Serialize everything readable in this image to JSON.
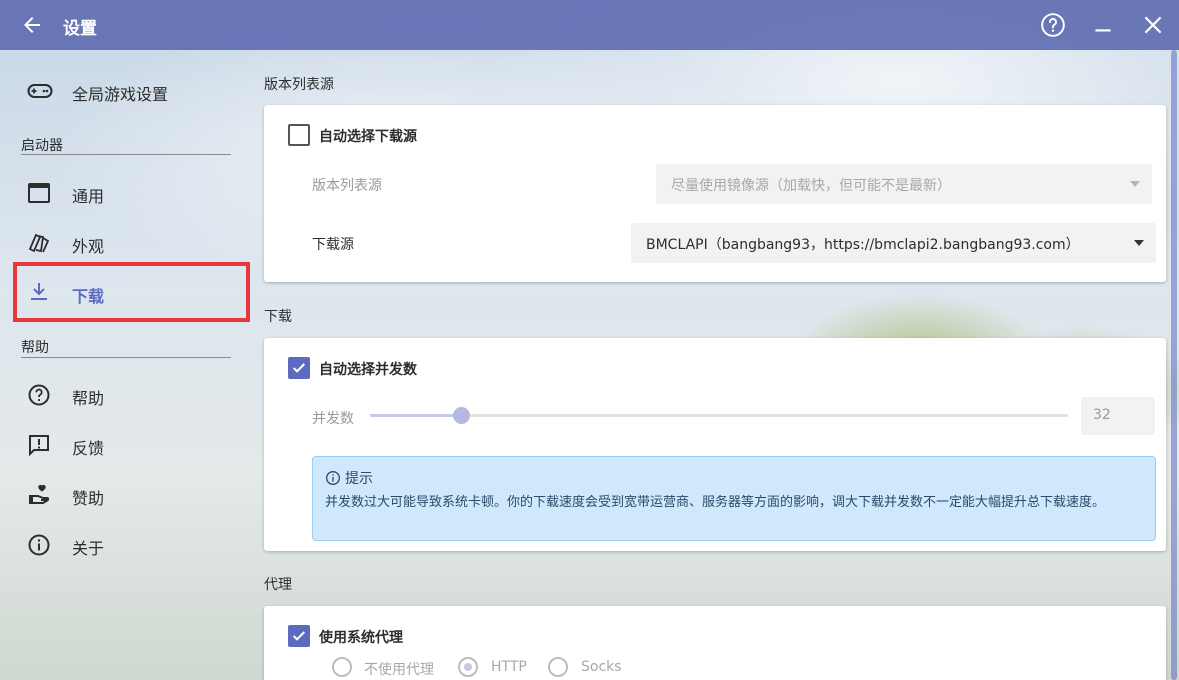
{
  "window": {
    "title": "设置",
    "accent_color": "#5c6bc0",
    "titlebar_color": "#606eb2"
  },
  "titlebar_icons": {
    "back": "arrow-left-icon",
    "help": "help-circle-icon",
    "minimize": "minimize-icon",
    "close": "close-icon"
  },
  "sidebar": {
    "top_item": {
      "label": "全局游戏设置",
      "icon": "gamepad-icon"
    },
    "launcher_section": "启动器",
    "launcher_items": [
      {
        "label": "通用",
        "icon": "window-icon"
      },
      {
        "label": "外观",
        "icon": "cards-icon"
      },
      {
        "label": "下载",
        "icon": "download-icon",
        "active": true
      }
    ],
    "help_section": "帮助",
    "help_items": [
      {
        "label": "帮助",
        "icon": "help-circle-icon"
      },
      {
        "label": "反馈",
        "icon": "feedback-icon"
      },
      {
        "label": "赞助",
        "icon": "donate-icon"
      },
      {
        "label": "关于",
        "icon": "info-icon"
      }
    ]
  },
  "version_source": {
    "group_title": "版本列表源",
    "auto_checkbox_label": "自动选择下载源",
    "auto_checked": false,
    "list_source_label": "版本列表源",
    "list_source_value": "尽量使用镜像源（加载快，但可能不是最新）",
    "download_source_label": "下载源",
    "download_source_value": "BMCLAPI（bangbang93，https://bmclapi2.bangbang93.com）"
  },
  "download": {
    "group_title": "下载",
    "auto_threads_label": "自动选择并发数",
    "auto_threads_checked": true,
    "threads_label": "并发数",
    "threads_value": "32",
    "threads_fraction": 0.13,
    "hint_title": "提示",
    "hint_text": "并发数过大可能导致系统卡顿。你的下载速度会受到宽带运营商、服务器等方面的影响，调大下载并发数不一定能大幅提升总下载速度。"
  },
  "proxy": {
    "group_title": "代理",
    "system_proxy_label": "使用系统代理",
    "system_proxy_checked": true,
    "options": [
      {
        "label": "不使用代理",
        "selected": false
      },
      {
        "label": "HTTP",
        "selected": true
      },
      {
        "label": "Socks",
        "selected": false
      }
    ]
  }
}
